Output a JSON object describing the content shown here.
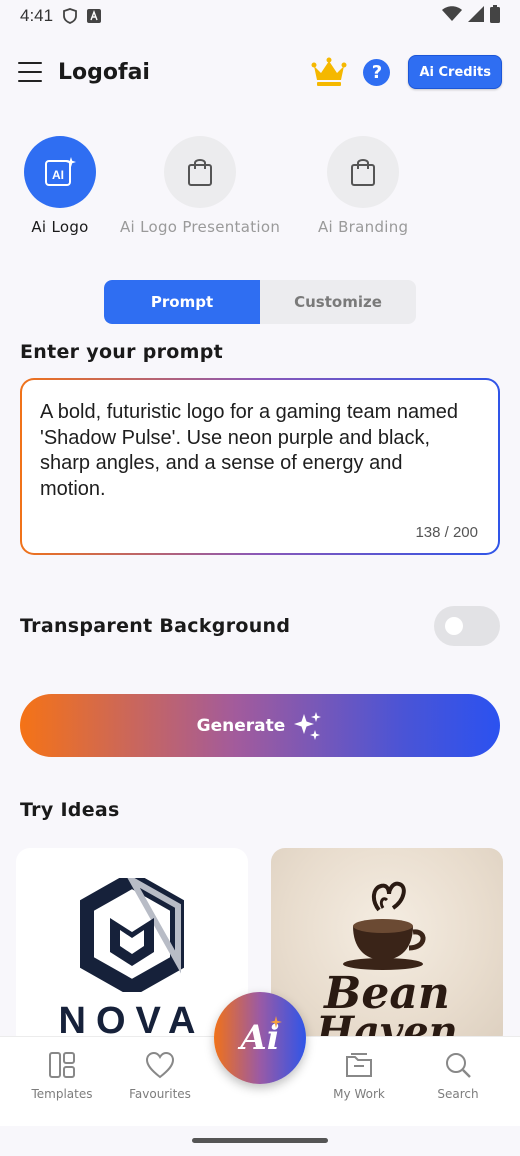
{
  "status_bar": {
    "time": "4:41"
  },
  "app_bar": {
    "title": "Logofai",
    "credits_label": "Ai Credits",
    "help_label": "?"
  },
  "tools": [
    {
      "label": "Ai Logo",
      "icon": "ai-icon",
      "active": true
    },
    {
      "label": "Ai Logo Presentation",
      "icon": "shopping-bag-icon",
      "active": false
    },
    {
      "label": "Ai Branding",
      "icon": "shopping-bag-icon",
      "active": false
    }
  ],
  "segmented": {
    "prompt": "Prompt",
    "customize": "Customize"
  },
  "prompt_section": {
    "title": "Enter your prompt",
    "value": "A bold, futuristic logo for a gaming team named 'Shadow Pulse'. Use neon purple and black, sharp angles, and a sense of energy and motion.",
    "counter": "138 / 200"
  },
  "transparent_background": {
    "label": "Transparent Background",
    "enabled": false
  },
  "generate": {
    "label": "Generate"
  },
  "ideas": {
    "title": "Try Ideas",
    "items": [
      {
        "text": "NOVA"
      },
      {
        "text_line1": "Bean",
        "text_line2": "Haven"
      }
    ]
  },
  "bottom_nav": {
    "items": [
      {
        "label": "Templates",
        "icon": "templates-icon"
      },
      {
        "label": "Favourites",
        "icon": "heart-icon"
      },
      {
        "label": "My Work",
        "icon": "folder-icon"
      },
      {
        "label": "Search",
        "icon": "search-icon"
      }
    ],
    "fab_label": "Ai"
  },
  "colors": {
    "primary": "#2f6ef2",
    "gradient_start": "#f57316",
    "gradient_end": "#2b52f0"
  }
}
